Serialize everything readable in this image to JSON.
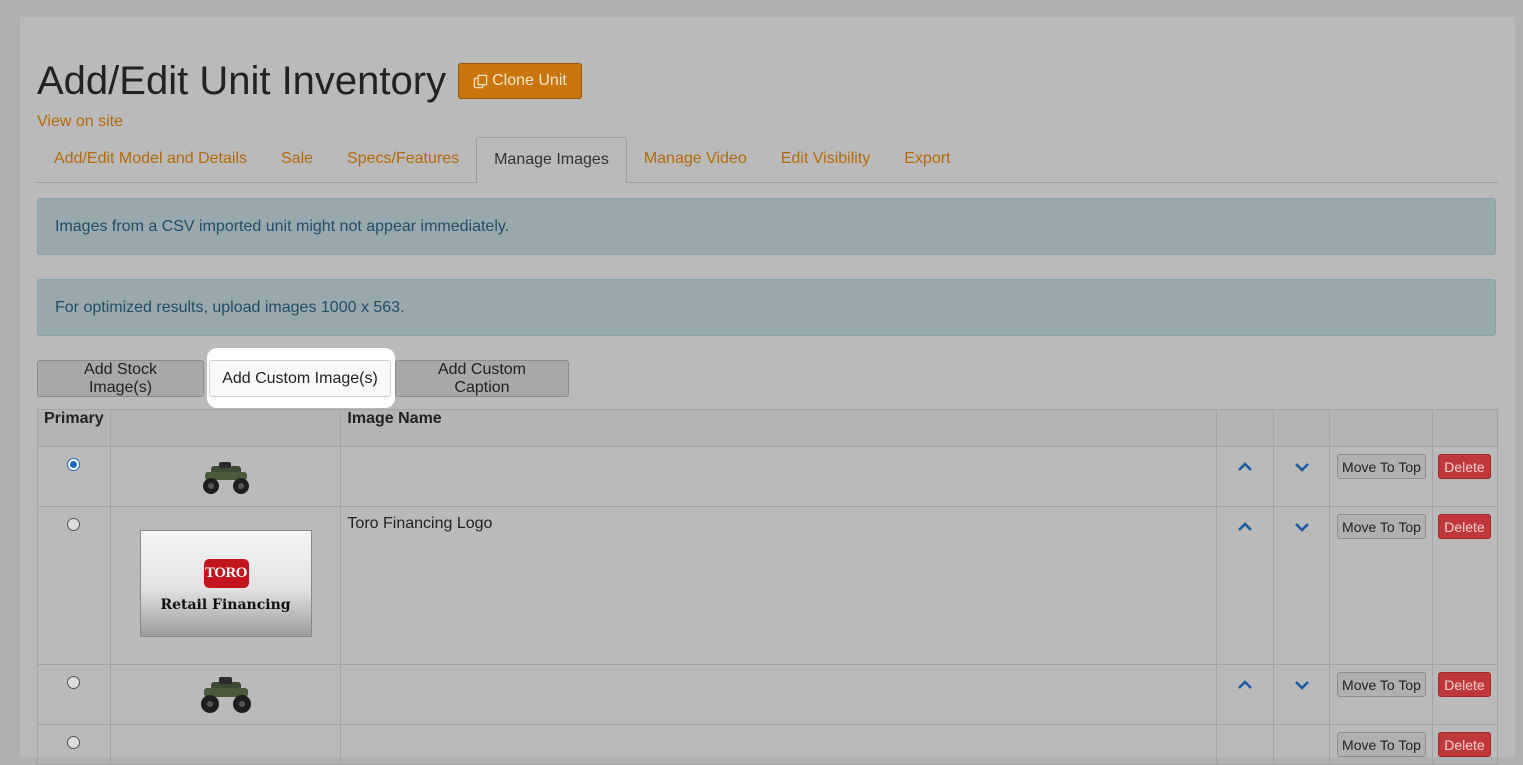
{
  "header": {
    "title": "Add/Edit Unit Inventory",
    "clone_label": "Clone Unit",
    "view_link": "View on site"
  },
  "tabs": [
    {
      "label": "Add/Edit Model and Details",
      "active": false
    },
    {
      "label": "Sale",
      "active": false
    },
    {
      "label": "Specs/Features",
      "active": false
    },
    {
      "label": "Manage Images",
      "active": true
    },
    {
      "label": "Manage Video",
      "active": false
    },
    {
      "label": "Edit Visibility",
      "active": false
    },
    {
      "label": "Export",
      "active": false
    }
  ],
  "alerts": {
    "csv_notice": "Images from a CSV imported unit might not appear immediately.",
    "size_notice": "For optimized results, upload images 1000 x 563."
  },
  "actions": {
    "add_stock": "Add Stock Image(s)",
    "add_custom": "Add Custom Image(s)",
    "add_caption": "Add Custom Caption"
  },
  "table": {
    "headers": {
      "primary": "Primary",
      "thumbnail": "",
      "image_name": "Image Name"
    },
    "move_to_top_label": "Move To Top",
    "delete_label": "Delete",
    "rows": [
      {
        "primary": true,
        "thumbnail": "atv-icon",
        "image_name": ""
      },
      {
        "primary": false,
        "thumbnail": "toro-financing-logo",
        "image_name": "Toro Financing Logo",
        "logo_badge": "TORO",
        "logo_text": "Retail Financing"
      },
      {
        "primary": false,
        "thumbnail": "atv-icon",
        "image_name": ""
      }
    ]
  },
  "colors": {
    "accent": "#c9760f",
    "link": "#b36a0c",
    "danger": "#c0393a",
    "arrow": "#1d5d9e"
  }
}
